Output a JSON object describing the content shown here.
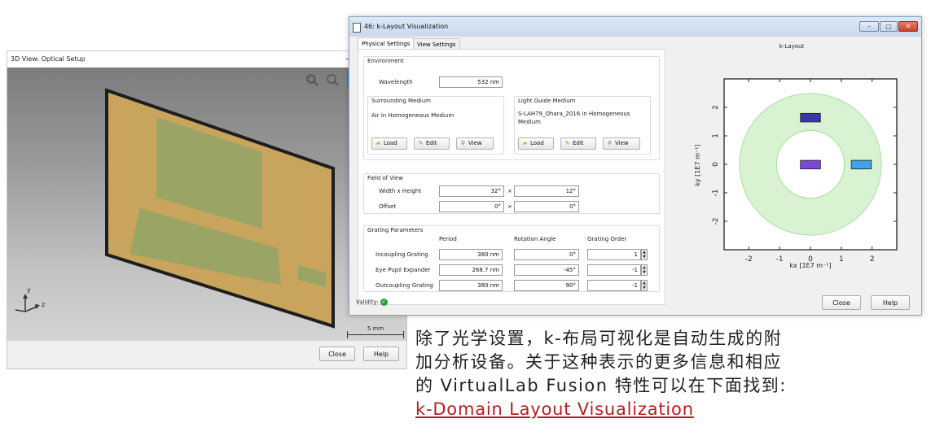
{
  "setup_window": {
    "title": "3D View: Optical Setup",
    "min_glyph": "–",
    "scale_label": "5 mm",
    "axes": {
      "y": "y",
      "z": "z"
    },
    "buttons": {
      "close": "Close",
      "help": "Help"
    },
    "icons": [
      "zoom-rect-icon",
      "zoom-icon"
    ]
  },
  "klayout_window": {
    "title": "46: k-Layout Visualization",
    "tabs": [
      "Physical Settings",
      "View Settings"
    ],
    "environment": {
      "label": "Environment",
      "wavelength_label": "Wavelength",
      "wavelength_value": "532 nm",
      "surrounding_label": "Surrounding Medium",
      "surrounding_value": "Air in Homogeneous Medium",
      "guide_label": "Light Guide Medium",
      "guide_value": "S-LAH79_Ohara_2016 in Homogeneous Medium",
      "load": "Load",
      "edit": "Edit",
      "view": "View"
    },
    "fov": {
      "label": "Field of View",
      "wh_label": "Width x Height",
      "width": "32°",
      "height": "12°",
      "offset_label": "Offset",
      "offset_x": "0°",
      "offset_y": "0°",
      "times": "×"
    },
    "grating": {
      "label": "Grating Parameters",
      "col_period": "Period",
      "col_rotation": "Rotation Angle",
      "col_order": "Grating Order",
      "rows": [
        {
          "name": "Incoupling Grating",
          "period": "380 nm",
          "rotation": "0°",
          "order": "1"
        },
        {
          "name": "Eye Pupil Expander",
          "period": "268.7 nm",
          "rotation": "-45°",
          "order": "-1"
        },
        {
          "name": "Outcoupling Grating",
          "period": "380 nm",
          "rotation": "90°",
          "order": "-1"
        }
      ]
    },
    "validity_label": "Validity:",
    "buttons": {
      "close": "Close",
      "help": "Help"
    }
  },
  "chart_data": {
    "type": "scatter",
    "title": "k-Layout",
    "xlabel": "kx [1E7 m⁻¹]",
    "ylabel": "ky [1E7 m⁻¹]",
    "xlim": [
      -2.8,
      2.8
    ],
    "ylim": [
      -3.0,
      3.0
    ],
    "xticks": [
      -2,
      -1,
      0,
      1,
      2
    ],
    "yticks": [
      -2,
      -1,
      0,
      1,
      2
    ],
    "rings": {
      "inner": 1.1,
      "outer": 2.3,
      "color": "#d9f3d2",
      "edge": "#a7dea0"
    },
    "boxes": [
      {
        "cx": 0.0,
        "cy": 1.65,
        "w": 0.65,
        "h": 0.28,
        "color": "#3838a8"
      },
      {
        "cx": 0.0,
        "cy": 0.0,
        "w": 0.65,
        "h": 0.28,
        "color": "#7b49d8"
      },
      {
        "cx": 1.65,
        "cy": 0.0,
        "w": 0.65,
        "h": 0.28,
        "color": "#3fa3ea"
      }
    ]
  },
  "caption": {
    "line1": "除了光学设置，k-布局可视化是自动生成的附",
    "line2": "加分析设备。关于这种表示的更多信息和相应",
    "line3": "的 VirtualLab Fusion 特性可以在下面找到:",
    "link": "k-Domain Layout Visualization"
  }
}
